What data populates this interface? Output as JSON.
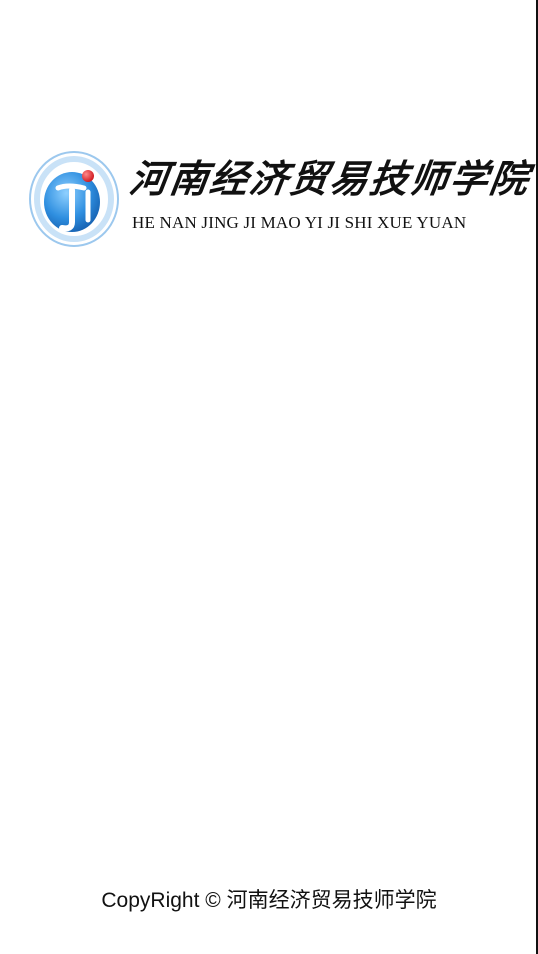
{
  "splash": {
    "logo": {
      "name_cn": "河南经济贸易技师学院",
      "name_en": "HE NAN JING JI MAO YI JI SHI XUE YUAN",
      "emblem_icon": "school-emblem-icon",
      "emblem_text_top": "河南经济贸易技师学院",
      "emblem_text_bottom": "HENANJINGJIMAOYIJISHIXUEYUAN",
      "emblem_colors": {
        "outer_ring": "#2a7fd0",
        "inner_blue": "#1f7fd6",
        "red_ball": "#e2252b"
      }
    },
    "footer_text": "CopyRight © 河南经济贸易技师学院"
  }
}
